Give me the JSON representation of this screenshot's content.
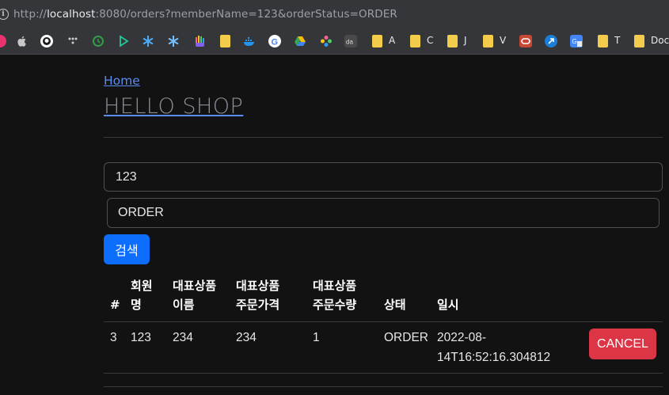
{
  "browser": {
    "url_prefix": "http://",
    "url_host": "localhost",
    "url_rest": ":8080/orders?memberName=123&orderStatus=ORDER",
    "bookmarks": [
      {
        "label": "A"
      },
      {
        "label": "C"
      },
      {
        "label": "J"
      },
      {
        "label": "V"
      },
      {
        "label": "T"
      },
      {
        "label": "Doc"
      }
    ]
  },
  "page": {
    "home_link": "Home",
    "brand": "HELLO SHOP",
    "search": {
      "member_name_value": "123",
      "order_status_value": "ORDER",
      "button_label": "검색"
    },
    "table": {
      "headers": {
        "id": "#",
        "member_line1": "회원",
        "member_line2": "명",
        "item_name_line1": "대표상품",
        "item_name_line2": "이름",
        "item_price_line1": "대표상품",
        "item_price_line2": "주문가격",
        "item_count_line1": "대표상품",
        "item_count_line2": "주문수량",
        "status": "상태",
        "date": "일시"
      },
      "rows": [
        {
          "id": "3",
          "member": "123",
          "item_name": "234",
          "item_price": "234",
          "item_count": "1",
          "status": "ORDER",
          "date_line1": "2022-08-",
          "date_line2": "14T16:52:16.304812",
          "cancel_label": "CANCEL"
        }
      ]
    }
  },
  "colors": {
    "primary": "#0d6efd",
    "danger": "#dc3545",
    "link": "#5a8cf0"
  }
}
